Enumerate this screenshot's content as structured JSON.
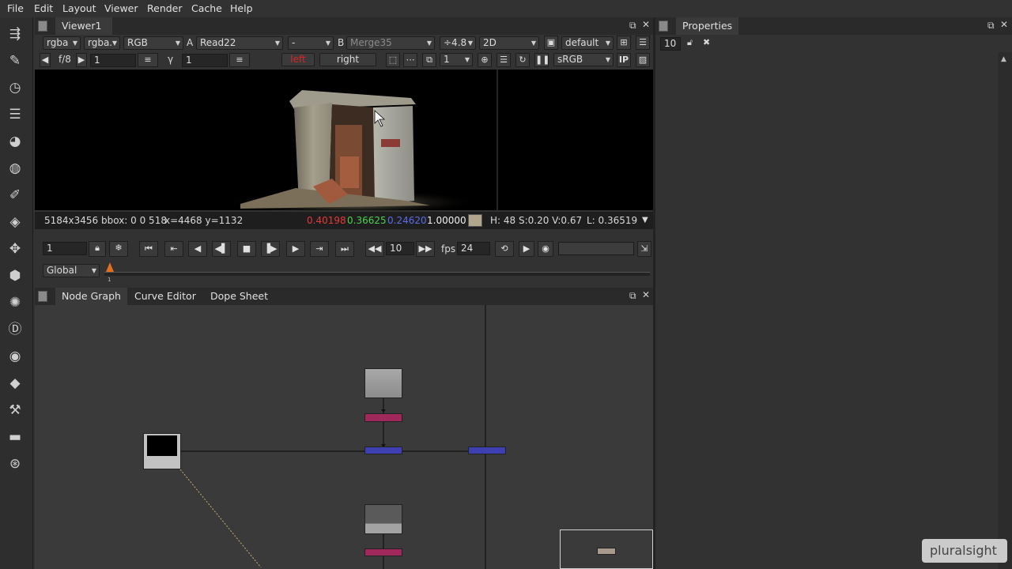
{
  "menu": [
    "File",
    "Edit",
    "Layout",
    "Viewer",
    "Render",
    "Cache",
    "Help"
  ],
  "toolbar_icons": [
    "layers-transfer-icon",
    "brush-icon",
    "clock-icon",
    "channel-stack-icon",
    "color-wheel-icon",
    "circle-icon",
    "paint-bucket-icon",
    "3d-layers-icon",
    "move-icon",
    "cube-icon",
    "particles-icon",
    "d-icon",
    "eye-icon",
    "tag-icon",
    "wrench-icon",
    "folder-icon",
    "fire-icon"
  ],
  "viewer": {
    "tab": "Viewer1",
    "channels": "rgba",
    "alpha": "rgba.",
    "display_channel": "RGB",
    "input_a_label": "A",
    "input_a": "Read22",
    "composite": "-",
    "input_b_label": "B",
    "input_b": "Merge35",
    "gain_label": "÷4.8",
    "view_mode": "2D",
    "lut": "default",
    "fstop": "f/8",
    "gain_value": "1",
    "gamma_label": "γ",
    "gamma_value": "1",
    "eye_left": "left",
    "eye_right": "right",
    "proxy_value": "1",
    "colorspace": "sRGB",
    "ip_label": "IP"
  },
  "info": {
    "resolution": "5184x3456 bbox: 0 0 518",
    "coords": "x=4468 y=1132",
    "r": "0.40198",
    "g": "0.36625",
    "b": "0.24620",
    "a": "1.00000",
    "hsv": "H: 48 S:0.20 V:0.67",
    "luma": "L: 0.36519",
    "swatch": "#b1a68b"
  },
  "timeline": {
    "frame": "1",
    "step": "10",
    "fps_label": "fps",
    "fps": "24",
    "scope": "Global",
    "start_tick": "1"
  },
  "tabs": {
    "node_graph": "Node Graph",
    "curve_editor": "Curve Editor",
    "dope_sheet": "Dope Sheet",
    "properties": "Properties",
    "max_panels": "10"
  },
  "colors": {
    "merge_node": "#3e3fb0",
    "grade_node": "#a0285a",
    "read_node": "#a6a6a6",
    "eye_left": "#d8262a"
  },
  "watermark": "pluralsight"
}
